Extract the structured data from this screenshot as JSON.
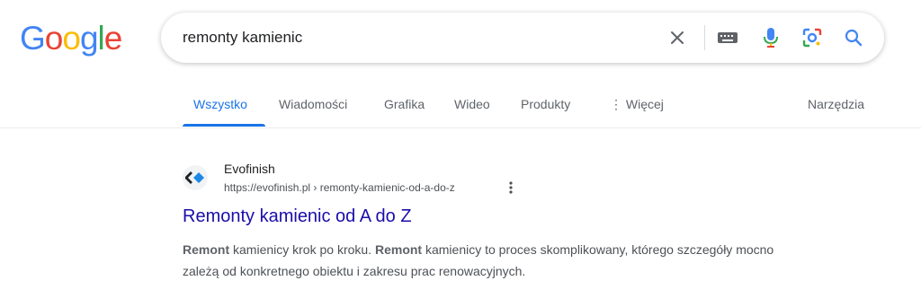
{
  "logo": {
    "letters": [
      "G",
      "o",
      "o",
      "g",
      "l",
      "e"
    ],
    "colors": [
      "#4285F4",
      "#EA4335",
      "#FBBC05",
      "#4285F4",
      "#34A853",
      "#EA4335"
    ]
  },
  "search": {
    "query": "remonty kamienic",
    "icons": [
      "clear-icon",
      "keyboard-icon",
      "mic-icon",
      "lens-icon",
      "search-icon"
    ]
  },
  "tabs": [
    {
      "label": "Wszystko",
      "active": true
    },
    {
      "label": "Wiadomości",
      "active": false
    },
    {
      "label": "Grafika",
      "active": false
    },
    {
      "label": "Wideo",
      "active": false
    },
    {
      "label": "Produkty",
      "active": false
    },
    {
      "label": "⋮ Więcej",
      "active": false
    }
  ],
  "tools_label": "Narzędzia",
  "result": {
    "site_name": "Evofinish",
    "url": "https://evofinish.pl › remonty-kamienic-od-a-do-z",
    "title": "Remonty kamienic od A do Z",
    "snippet_parts": [
      {
        "text": "Remont",
        "bold": true
      },
      {
        "text": " kamienicy krok po kroku. ",
        "bold": false
      },
      {
        "text": "Remont",
        "bold": true
      },
      {
        "text": " kamienicy to proces skomplikowany, którego szczegóły mocno zależą od konkretnego obiektu i zakresu prac renowacyjnych.",
        "bold": false
      }
    ]
  },
  "colors": {
    "accent": "#1a73e8",
    "link": "#1a0dab"
  }
}
